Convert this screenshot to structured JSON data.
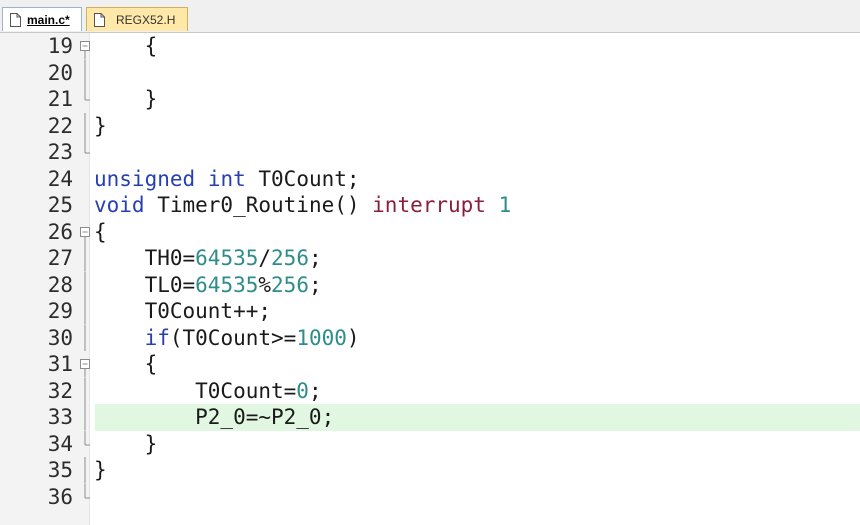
{
  "tabs": [
    {
      "label": "main.c*",
      "active": true
    },
    {
      "label": "REGX52.H",
      "active": false
    }
  ],
  "colors": {
    "keyword": "#2640b4",
    "number": "#2f8c8c",
    "interrupt_keyword": "#8a1f3c",
    "current_line_highlight": "#e2f7e2"
  },
  "editor": {
    "current_line": "33",
    "lines": [
      {
        "no": "19",
        "fold": "open",
        "segments": [
          {
            "t": "    {",
            "c": "plain"
          }
        ]
      },
      {
        "no": "20",
        "fold": "bar",
        "segments": []
      },
      {
        "no": "21",
        "fold": "end",
        "segments": [
          {
            "t": "    }",
            "c": "plain"
          }
        ]
      },
      {
        "no": "22",
        "fold": "bar",
        "segments": [
          {
            "t": "}",
            "c": "plain"
          }
        ]
      },
      {
        "no": "23",
        "fold": "end",
        "segments": []
      },
      {
        "no": "24",
        "fold": "none",
        "segments": [
          {
            "t": "unsigned",
            "c": "kw"
          },
          {
            "t": " ",
            "c": "plain"
          },
          {
            "t": "int",
            "c": "kw"
          },
          {
            "t": " T0Count;",
            "c": "plain"
          }
        ]
      },
      {
        "no": "25",
        "fold": "none",
        "segments": [
          {
            "t": "void",
            "c": "kw"
          },
          {
            "t": " Timer0_Routine() ",
            "c": "plain"
          },
          {
            "t": "interrupt",
            "c": "intr"
          },
          {
            "t": " ",
            "c": "plain"
          },
          {
            "t": "1",
            "c": "num"
          }
        ]
      },
      {
        "no": "26",
        "fold": "open",
        "segments": [
          {
            "t": "{",
            "c": "plain"
          }
        ]
      },
      {
        "no": "27",
        "fold": "bar",
        "segments": [
          {
            "t": "    TH0=",
            "c": "plain"
          },
          {
            "t": "64535",
            "c": "num"
          },
          {
            "t": "/",
            "c": "plain"
          },
          {
            "t": "256",
            "c": "num"
          },
          {
            "t": ";",
            "c": "plain"
          }
        ]
      },
      {
        "no": "28",
        "fold": "bar",
        "segments": [
          {
            "t": "    TL0=",
            "c": "plain"
          },
          {
            "t": "64535",
            "c": "num"
          },
          {
            "t": "%",
            "c": "plain"
          },
          {
            "t": "256",
            "c": "num"
          },
          {
            "t": ";",
            "c": "plain"
          }
        ]
      },
      {
        "no": "29",
        "fold": "bar",
        "segments": [
          {
            "t": "    T0Count++;",
            "c": "plain"
          }
        ]
      },
      {
        "no": "30",
        "fold": "bar",
        "segments": [
          {
            "t": "    ",
            "c": "plain"
          },
          {
            "t": "if",
            "c": "kw"
          },
          {
            "t": "(T0Count>=",
            "c": "plain"
          },
          {
            "t": "1000",
            "c": "num"
          },
          {
            "t": ")",
            "c": "plain"
          }
        ]
      },
      {
        "no": "31",
        "fold": "open",
        "segments": [
          {
            "t": "    {",
            "c": "plain"
          }
        ]
      },
      {
        "no": "32",
        "fold": "bar",
        "segments": [
          {
            "t": "        T0Count=",
            "c": "plain"
          },
          {
            "t": "0",
            "c": "num"
          },
          {
            "t": ";",
            "c": "plain"
          }
        ]
      },
      {
        "no": "33",
        "fold": "bar",
        "segments": [
          {
            "t": "        P2_0=~P2_0;",
            "c": "plain"
          }
        ]
      },
      {
        "no": "34",
        "fold": "end",
        "segments": [
          {
            "t": "    }",
            "c": "plain"
          }
        ]
      },
      {
        "no": "35",
        "fold": "bar",
        "segments": [
          {
            "t": "}",
            "c": "plain"
          }
        ]
      },
      {
        "no": "36",
        "fold": "end",
        "segments": []
      }
    ]
  }
}
